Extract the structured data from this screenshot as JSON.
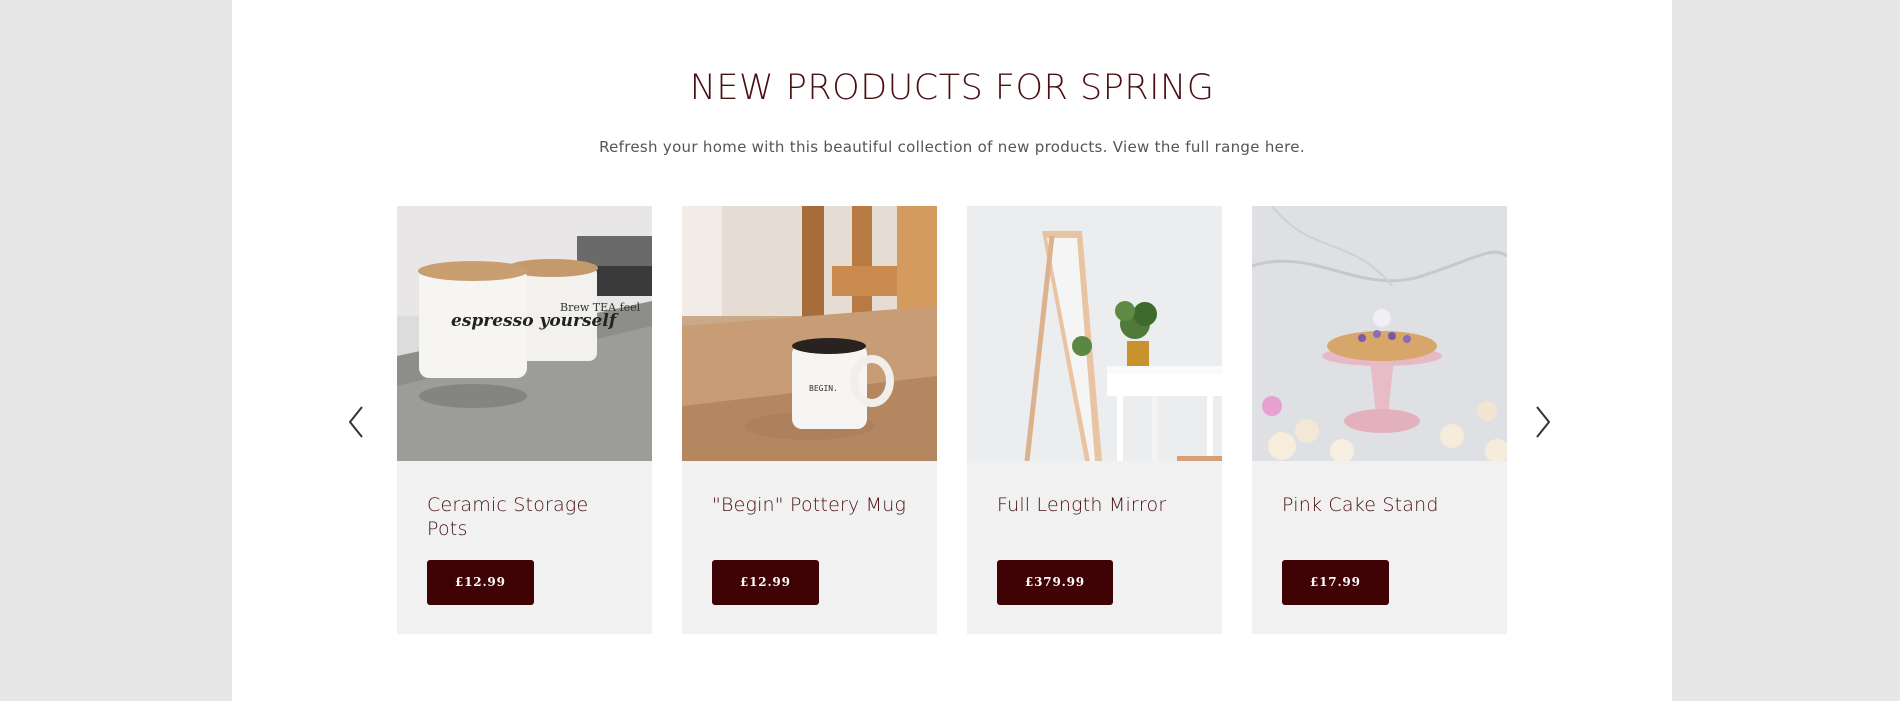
{
  "section": {
    "title": "NEW PRODUCTS FOR SPRING",
    "subtitle": "Refresh your home with this beautiful collection of new products. View the full range here."
  },
  "carousel": {
    "prev_icon": "chevron-left-icon",
    "next_icon": "chevron-right-icon"
  },
  "products": [
    {
      "name": "Ceramic Storage Pots",
      "price": "£12.99",
      "image": "ceramic-pots-image",
      "image_text_1": "espresso yourself",
      "image_text_2": "Brew TEA feel"
    },
    {
      "name": "\"Begin\" Pottery Mug",
      "price": "£12.99",
      "image": "pottery-mug-image",
      "image_text_1": "BEGIN."
    },
    {
      "name": "Full Length Mirror",
      "price": "£379.99",
      "image": "mirror-image"
    },
    {
      "name": "Pink Cake Stand",
      "price": "£17.99",
      "image": "cake-stand-image"
    }
  ],
  "colors": {
    "accent": "#3f0306",
    "heading": "#4a0f12",
    "card_bg": "#f1f1f1",
    "page_bg": "#e7e7e7"
  }
}
